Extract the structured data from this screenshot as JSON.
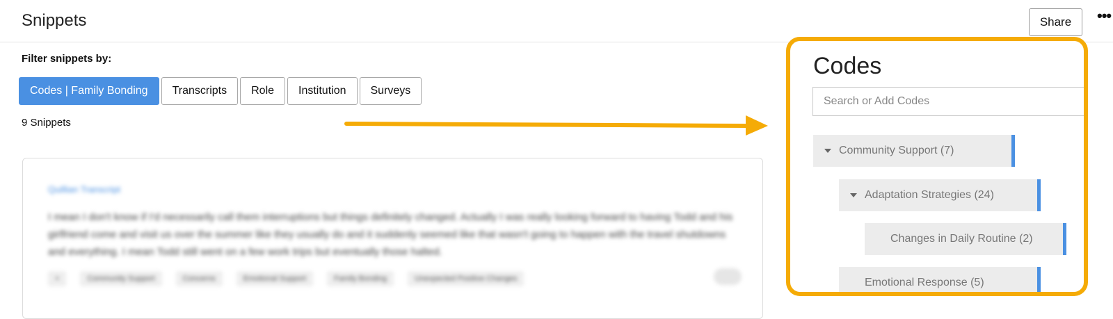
{
  "header": {
    "title": "Snippets",
    "share_label": "Share",
    "more_label": "•••"
  },
  "filter": {
    "label": "Filter snippets by:",
    "buttons": [
      {
        "label": "Codes | Family Bonding",
        "active": true
      },
      {
        "label": "Transcripts",
        "active": false
      },
      {
        "label": "Role",
        "active": false
      },
      {
        "label": "Institution",
        "active": false
      },
      {
        "label": "Surveys",
        "active": false
      }
    ]
  },
  "snippet_count": "9 Snippets",
  "snippet_card": {
    "title": "Quillian Transcript",
    "text": "I mean I don't know if I'd necessarily call them interruptions but things definitely changed. Actually I was really looking forward to having Todd and his girlfriend come and visit us over the summer like they usually do and it suddenly seemed like that wasn't going to happen with the travel shutdowns and everything. I mean Todd still went on a few work trips but eventually those halted.",
    "tags": [
      "+",
      "Community Support",
      "Concerns",
      "Emotional Support",
      "Family Bonding",
      "Unexpected Positive Changes"
    ]
  },
  "codes_panel": {
    "title": "Codes",
    "search_placeholder": "Search or Add Codes",
    "items": [
      {
        "label": "Community Support (7)",
        "level": 0,
        "expanded": true
      },
      {
        "label": "Adaptation Strategies (24)",
        "level": 1,
        "expanded": true
      },
      {
        "label": "Changes in Daily Routine (2)",
        "level": 2,
        "expanded": false
      },
      {
        "label": "Emotional Response (5)",
        "level": 1,
        "expanded": false
      }
    ]
  },
  "colors": {
    "accent": "#4a90e2",
    "highlight": "#f5ab06"
  }
}
